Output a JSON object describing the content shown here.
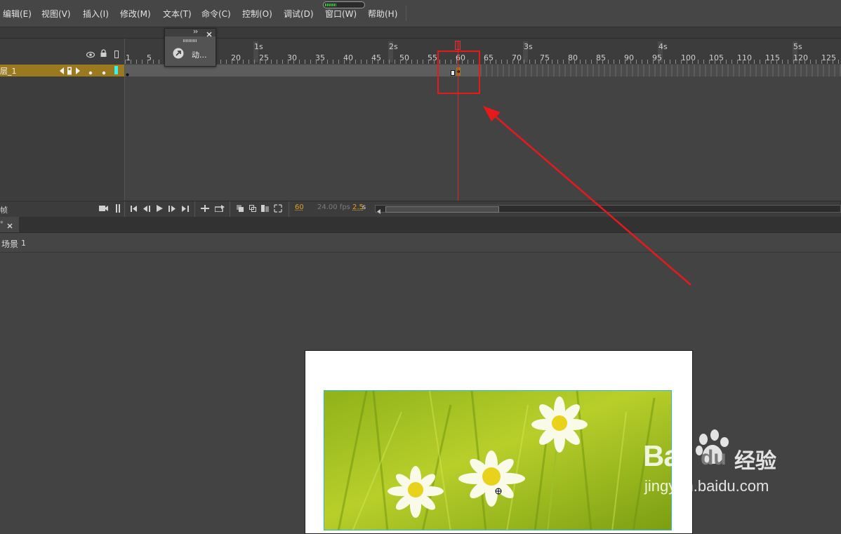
{
  "menu": {
    "items": [
      "编辑(E)",
      "视图(V)",
      "插入(I)",
      "修改(M)",
      "文本(T)",
      "命令(C)",
      "控制(O)",
      "调试(D)",
      "窗口(W)",
      "帮助(H)"
    ]
  },
  "performance_meter": {
    "fill_percent": 30
  },
  "timeline": {
    "layer_name": "层_1",
    "second_labels": [
      "1s",
      "2s",
      "3s",
      "4s",
      "5s"
    ],
    "frame_labels": [
      "1",
      "5",
      "20",
      "25",
      "30",
      "35",
      "40",
      "45",
      "50",
      "55",
      "60",
      "65",
      "70",
      "75",
      "80",
      "85",
      "90",
      "95",
      "100",
      "105",
      "110",
      "115",
      "120",
      "125"
    ],
    "current_frame": "60",
    "fps": "24.00 fps",
    "time": "2.5",
    "time_unit": "s",
    "left_label": "帧"
  },
  "float_panel": {
    "label": "动..."
  },
  "breadcrumb": {
    "scene": "场景",
    "scene_number": "1"
  },
  "watermark": {
    "brand_left": "Bai",
    "brand_right": "du",
    "cn": "经验",
    "url": "jingyan.baidu.com"
  },
  "colors": {
    "layer_active": "#9b7a1f",
    "playhead": "#d92a2a",
    "annotation": "#e8191b",
    "stage_border": "#3fb7cf",
    "orange_text": "#e0a020"
  }
}
